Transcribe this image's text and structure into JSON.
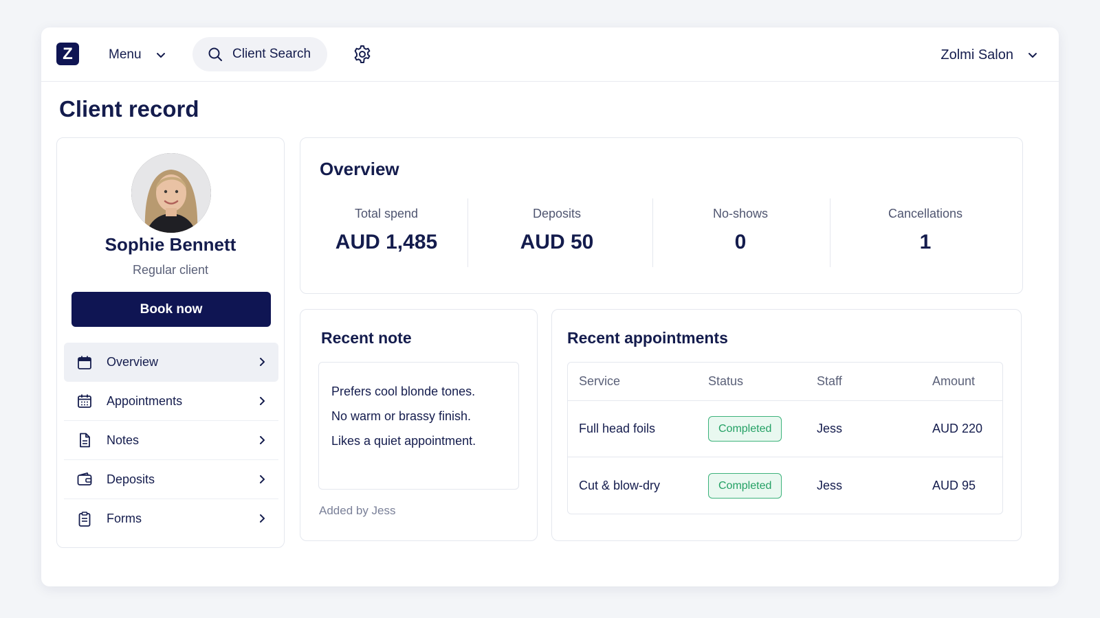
{
  "topbar": {
    "logo_letter": "Z",
    "menu_label": "Menu",
    "search_label": "Client Search",
    "salon_name": "Zolmi Salon"
  },
  "page": {
    "title": "Client record"
  },
  "client": {
    "name": "Sophie Bennett",
    "type": "Regular client",
    "book_label": "Book now"
  },
  "nav": {
    "items": [
      {
        "label": "Overview",
        "icon": "calendar-icon",
        "active": true
      },
      {
        "label": "Appointments",
        "icon": "calendar-grid-icon",
        "active": false
      },
      {
        "label": "Notes",
        "icon": "document-icon",
        "active": false
      },
      {
        "label": "Deposits",
        "icon": "wallet-icon",
        "active": false
      },
      {
        "label": "Forms",
        "icon": "clipboard-icon",
        "active": false
      }
    ]
  },
  "overview": {
    "title": "Overview",
    "stats": [
      {
        "label": "Total spend",
        "value": "AUD 1,485"
      },
      {
        "label": "Deposits",
        "value": "AUD 50"
      },
      {
        "label": "No-shows",
        "value": "0"
      },
      {
        "label": "Cancellations",
        "value": "1"
      }
    ]
  },
  "note": {
    "title": "Recent note",
    "lines": [
      "Prefers cool blonde tones.",
      "No warm or brassy finish.",
      "Likes a quiet appointment."
    ],
    "added_by": "Added by Jess"
  },
  "appointments": {
    "title": "Recent appointments",
    "columns": [
      "Service",
      "Status",
      "Staff",
      "Amount"
    ],
    "rows": [
      {
        "service": "Full head foils",
        "status": "Completed",
        "staff": "Jess",
        "amount": "AUD 220"
      },
      {
        "service": "Cut & blow-dry",
        "status": "Completed",
        "staff": "Jess",
        "amount": "AUD 95"
      }
    ]
  },
  "colors": {
    "brand_navy": "#0f1553",
    "status_green": "#23a064",
    "background": "#f3f5f8"
  }
}
